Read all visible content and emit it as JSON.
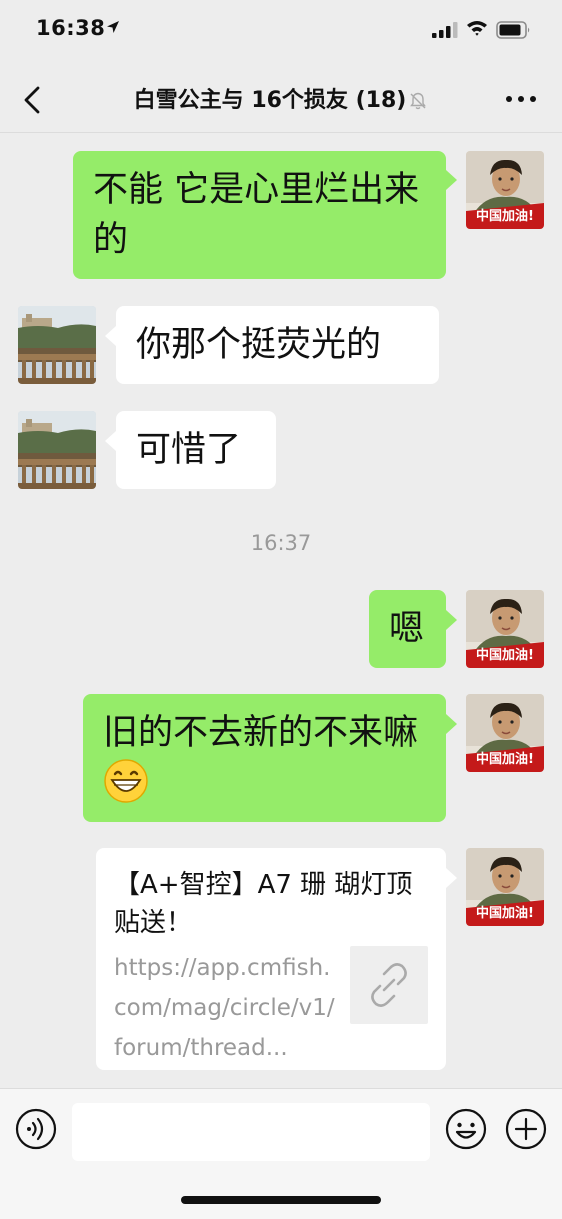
{
  "status": {
    "time": "16:38"
  },
  "nav": {
    "title": "白雪公主与 16个损友 (18)"
  },
  "messages": [
    {
      "text": "不能 它是心里烂出来的"
    },
    {
      "text": "你那个挺荧光的"
    },
    {
      "text": "可惜了"
    },
    {
      "text": "嗯"
    },
    {
      "text": "旧的不去新的不来嘛"
    }
  ],
  "time_separator": "16:37",
  "link_card": {
    "title": "【A+智控】A7 珊 瑚灯顶贴送！",
    "url": "https://app.cmfish.com/mag/circle/v1/forum/thread..."
  },
  "avatar_badge": "中国加油!",
  "input": {
    "placeholder": ""
  },
  "colors": {
    "my_bubble": "#95ec69",
    "other_bubble": "#ffffff",
    "background": "#ededed"
  }
}
